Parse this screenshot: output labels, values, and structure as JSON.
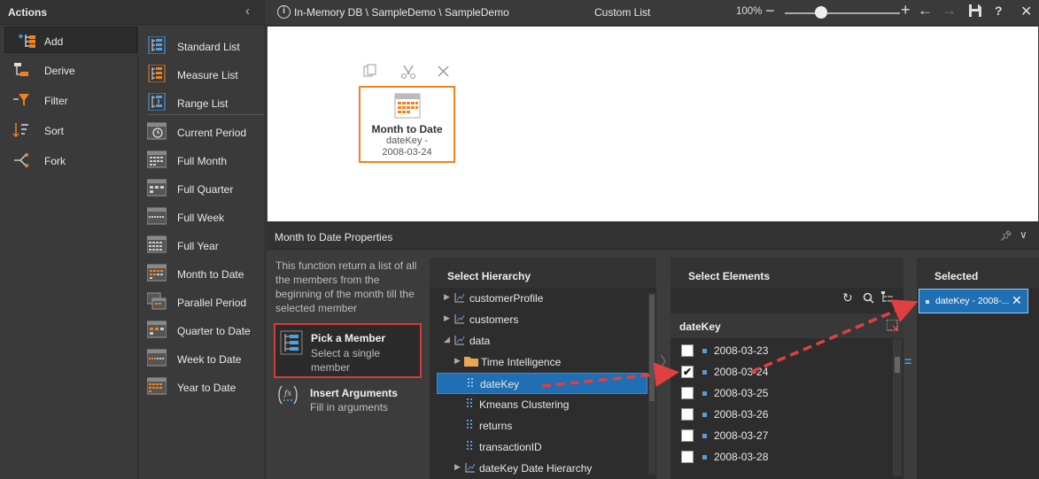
{
  "actions": {
    "title": "Actions",
    "primary": [
      {
        "label": "Add",
        "icon": "add-icon",
        "selected": true
      },
      {
        "label": "Derive",
        "icon": "derive-icon"
      },
      {
        "label": "Filter",
        "icon": "filter-icon"
      },
      {
        "label": "Sort",
        "icon": "sort-icon"
      },
      {
        "label": "Fork",
        "icon": "fork-icon"
      }
    ],
    "secondary": [
      {
        "label": "Standard List",
        "icon": "standard-list-icon"
      },
      {
        "label": "Measure List",
        "icon": "measure-list-icon"
      },
      {
        "label": "Range List",
        "icon": "range-list-icon"
      },
      {
        "label": "Current Period",
        "icon": "current-period-icon"
      },
      {
        "label": "Full Month",
        "icon": "full-month-icon"
      },
      {
        "label": "Full Quarter",
        "icon": "full-quarter-icon"
      },
      {
        "label": "Full Week",
        "icon": "full-week-icon"
      },
      {
        "label": "Full Year",
        "icon": "full-year-icon"
      },
      {
        "label": "Month to Date",
        "icon": "month-to-date-icon"
      },
      {
        "label": "Parallel Period",
        "icon": "parallel-period-icon"
      },
      {
        "label": "Quarter to Date",
        "icon": "quarter-to-date-icon"
      },
      {
        "label": "Week to Date",
        "icon": "week-to-date-icon"
      },
      {
        "label": "Year to Date",
        "icon": "year-to-date-icon"
      }
    ]
  },
  "topbar": {
    "breadcrumb": "In-Memory DB \\ SampleDemo \\ SampleDemo",
    "view_title": "Custom List",
    "zoom": "100%",
    "zoom_level": 0.26
  },
  "node": {
    "title": "Month to Date",
    "sub1": "dateKey -",
    "sub2": "2008-03-24"
  },
  "props": {
    "title": "Month to Date Properties",
    "description": "This function return a list of all the members from the beginning of the month till the selected member",
    "pick_title": "Pick a Member",
    "pick_sub": "Select a single member",
    "insert_title": "Insert Arguments",
    "insert_sub": "Fill in arguments"
  },
  "hierarchy": {
    "title": "Select Hierarchy",
    "items": [
      {
        "label": "customerProfile",
        "arrow": "▶",
        "icon": "hierarchy-icon"
      },
      {
        "label": "customers",
        "arrow": "▶",
        "icon": "hierarchy-icon"
      },
      {
        "label": "data",
        "arrow": "◢",
        "icon": "hierarchy-icon"
      },
      {
        "label": "Time Intelligence",
        "arrow": "▶",
        "icon": "folder-icon"
      },
      {
        "label": "dateKey",
        "arrow": "",
        "icon": "level-icon",
        "selected": true
      },
      {
        "label": "Kmeans Clustering",
        "arrow": "",
        "icon": "level-icon"
      },
      {
        "label": "returns",
        "arrow": "",
        "icon": "level-icon"
      },
      {
        "label": "transactionID",
        "arrow": "",
        "icon": "level-icon"
      },
      {
        "label": "dateKey Date Hierarchy",
        "arrow": "▶",
        "icon": "hierarchy-icon"
      }
    ]
  },
  "elements": {
    "title": "Select Elements",
    "level": "dateKey",
    "items": [
      {
        "label": "2008-03-23",
        "checked": false
      },
      {
        "label": "2008-03-24",
        "checked": true
      },
      {
        "label": "2008-03-25",
        "checked": false
      },
      {
        "label": "2008-03-26",
        "checked": false
      },
      {
        "label": "2008-03-27",
        "checked": false
      },
      {
        "label": "2008-03-28",
        "checked": false
      }
    ]
  },
  "selected": {
    "title": "Selected",
    "chip": "dateKey - 2008-..."
  },
  "colors": {
    "accent_orange": "#f0821f",
    "highlight_red": "#d43b3b",
    "selection_blue": "#1e6fb3",
    "arrow_red": "#e04040"
  }
}
